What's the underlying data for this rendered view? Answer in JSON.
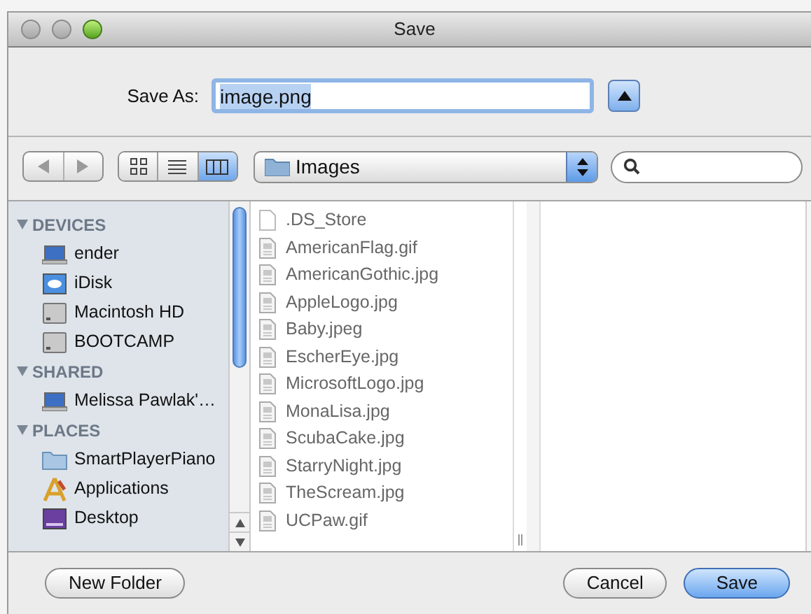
{
  "window": {
    "title": "Save"
  },
  "save_as": {
    "label": "Save As:",
    "value": "image.png"
  },
  "view_modes": [
    {
      "kind": "icon",
      "selected": false
    },
    {
      "kind": "list",
      "selected": false
    },
    {
      "kind": "column",
      "selected": true
    }
  ],
  "location": {
    "label": "Images"
  },
  "sidebar": [
    {
      "title": "DEVICES",
      "expanded": true,
      "items": [
        {
          "label": "ender",
          "kind": "laptop"
        },
        {
          "label": "iDisk",
          "kind": "idisk"
        },
        {
          "label": "Macintosh HD",
          "kind": "drive"
        },
        {
          "label": "BOOTCAMP",
          "kind": "drive"
        }
      ]
    },
    {
      "title": "SHARED",
      "expanded": true,
      "items": [
        {
          "label": "Melissa Pawlak'…",
          "kind": "laptop"
        }
      ]
    },
    {
      "title": "PLACES",
      "expanded": true,
      "items": [
        {
          "label": "SmartPlayerPiano",
          "kind": "folder"
        },
        {
          "label": "Applications",
          "kind": "applications"
        },
        {
          "label": "Desktop",
          "kind": "desktop"
        }
      ]
    }
  ],
  "files": [
    {
      "name": ".DS_Store",
      "kind": "blank"
    },
    {
      "name": "AmericanFlag.gif",
      "kind": "image"
    },
    {
      "name": "AmericanGothic.jpg",
      "kind": "image"
    },
    {
      "name": "AppleLogo.jpg",
      "kind": "image"
    },
    {
      "name": "Baby.jpeg",
      "kind": "image"
    },
    {
      "name": "EscherEye.jpg",
      "kind": "image"
    },
    {
      "name": "MicrosoftLogo.jpg",
      "kind": "image"
    },
    {
      "name": "MonaLisa.jpg",
      "kind": "image"
    },
    {
      "name": "ScubaCake.jpg",
      "kind": "image"
    },
    {
      "name": "StarryNight.jpg",
      "kind": "image"
    },
    {
      "name": "TheScream.jpg",
      "kind": "image"
    },
    {
      "name": "UCPaw.gif",
      "kind": "image"
    }
  ],
  "buttons": [
    {
      "label": "New Folder",
      "default": false
    },
    {
      "label": "Cancel",
      "default": false
    },
    {
      "label": "Save",
      "default": true
    }
  ]
}
